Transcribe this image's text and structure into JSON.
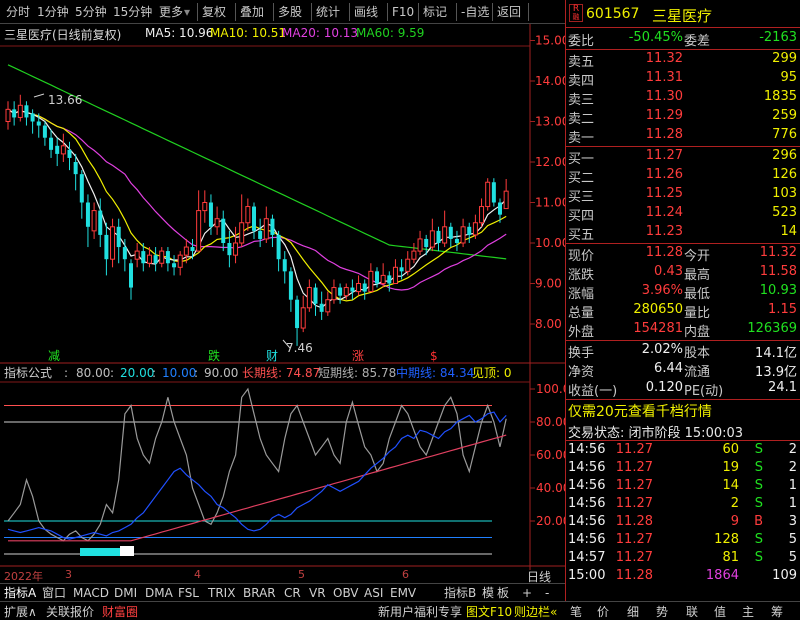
{
  "toolbar": {
    "items": [
      "分时",
      "1分钟",
      "5分钟",
      "15分钟",
      "更多",
      "复权",
      "叠加",
      "多股",
      "统计",
      "画线",
      "F10",
      "标记",
      "-自选",
      "返回"
    ]
  },
  "chart": {
    "title": "三星医疗(日线前复权)",
    "ma5": "MA5: 10.96",
    "ma10": "MA10: 10.51",
    "ma20": "MA20: 10.13",
    "ma60": "MA60: 9.59",
    "high_label": "13.66",
    "low_label": "7.46",
    "price_ticks": [
      "15.00",
      "14.00",
      "13.00",
      "12.00",
      "11.00",
      "10.00",
      "9.00",
      "8.00"
    ],
    "markers": [
      "减",
      "跌",
      "财",
      "涨",
      "$"
    ],
    "indicator_header": {
      "name": "指标公式",
      "v1": "80.00",
      "v2": "20.00",
      "v3": "10.00",
      "v4": "90.00",
      "long_line": "长期线: 74.87",
      "short_line": "短期线: 85.78",
      "mid_line": "中期线: 84.34",
      "top": "见顶: 0"
    },
    "indicator_ticks": [
      "100.0",
      "80.00",
      "60.00",
      "40.00",
      "20.00"
    ],
    "dates": [
      "2022年",
      "3",
      "4",
      "5",
      "6"
    ],
    "period": "日线",
    "colors": {
      "up": "#ff3c3c",
      "down": "#20e0e0",
      "ma5": "#f0f0f0",
      "ma10": "#f0f000",
      "ma20": "#e040e0",
      "ma60": "#20d020"
    }
  },
  "bottom_tabs": [
    "指标A",
    "窗口",
    "MACD",
    "DMI",
    "DMA",
    "FSL",
    "TRIX",
    "BRAR",
    "CR",
    "VR",
    "OBV",
    "ASI",
    "EMV",
    "指标B",
    "模",
    "板",
    "+",
    "-"
  ],
  "status_bar": {
    "items": [
      "扩展∧",
      "关联报价",
      "财富圈",
      "新用户福利专享",
      "图文F10",
      "则边栏«",
      "笔",
      "价",
      "细",
      "势",
      "联",
      "值",
      "主",
      "筹"
    ]
  },
  "quote": {
    "badge": "R",
    "badge_sub": "融",
    "code": "601567",
    "name": "三星医疗",
    "ratio_label": "委比",
    "ratio": "-50.45%",
    "diff_label": "委差",
    "diff": "-2163",
    "asks": [
      {
        "label": "卖五",
        "price": "11.32",
        "vol": "299"
      },
      {
        "label": "卖四",
        "price": "11.31",
        "vol": "95"
      },
      {
        "label": "卖三",
        "price": "11.30",
        "vol": "1835"
      },
      {
        "label": "卖二",
        "price": "11.29",
        "vol": "259"
      },
      {
        "label": "卖一",
        "price": "11.28",
        "vol": "776"
      }
    ],
    "bids": [
      {
        "label": "买一",
        "price": "11.27",
        "vol": "296"
      },
      {
        "label": "买二",
        "price": "11.26",
        "vol": "126"
      },
      {
        "label": "买三",
        "price": "11.25",
        "vol": "103"
      },
      {
        "label": "买四",
        "price": "11.24",
        "vol": "523"
      },
      {
        "label": "买五",
        "price": "11.23",
        "vol": "14"
      }
    ],
    "stats": [
      {
        "l1": "现价",
        "v1": "11.28",
        "l2": "今开",
        "v2": "11.32"
      },
      {
        "l1": "涨跌",
        "v1": "0.43",
        "l2": "最高",
        "v2": "11.58"
      },
      {
        "l1": "涨幅",
        "v1": "3.96%",
        "l2": "最低",
        "v2": "10.93"
      },
      {
        "l1": "总量",
        "v1": "280650",
        "l2": "量比",
        "v2": "1.15"
      },
      {
        "l1": "外盘",
        "v1": "154281",
        "l2": "内盘",
        "v2": "126369"
      }
    ],
    "fund": [
      {
        "l1": "换手",
        "v1": "2.02%",
        "l2": "股本",
        "v2": "14.1亿"
      },
      {
        "l1": "净资",
        "v1": "6.44",
        "l2": "流通",
        "v2": "13.9亿"
      },
      {
        "l1": "收益(一)",
        "v1": "0.120",
        "l2": "PE(动)",
        "v2": "24.1"
      }
    ],
    "promo": "仅需20元查看千档行情",
    "trade_status": "交易状态: 闭市阶段 15:00:03",
    "ticks": [
      {
        "time": "14:56",
        "price": "11.27",
        "vol": "60",
        "side": "S",
        "n": "2"
      },
      {
        "time": "14:56",
        "price": "11.27",
        "vol": "19",
        "side": "S",
        "n": "2"
      },
      {
        "time": "14:56",
        "price": "11.27",
        "vol": "14",
        "side": "S",
        "n": "1"
      },
      {
        "time": "14:56",
        "price": "11.27",
        "vol": "2",
        "side": "S",
        "n": "1"
      },
      {
        "time": "14:56",
        "price": "11.28",
        "vol": "9",
        "side": "B",
        "n": "3"
      },
      {
        "time": "14:56",
        "price": "11.27",
        "vol": "128",
        "side": "S",
        "n": "5"
      },
      {
        "time": "14:57",
        "price": "11.27",
        "vol": "81",
        "side": "S",
        "n": "5"
      },
      {
        "time": "15:00",
        "price": "11.28",
        "vol": "1864",
        "side": "",
        "n": "109"
      }
    ]
  }
}
